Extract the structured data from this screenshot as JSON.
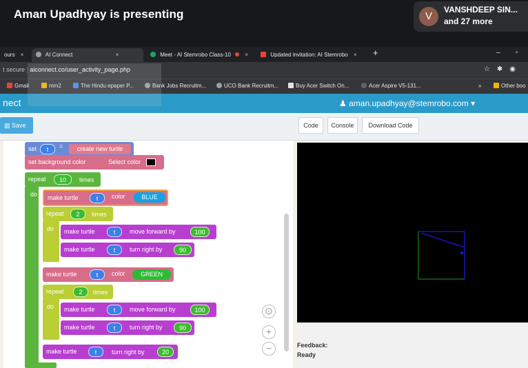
{
  "meet": {
    "presenting": "Aman Upadhyay is presenting",
    "presenter_initial": "V",
    "presenter_name": "VANSHDEEP SIN...",
    "participants_more": "and 27 more"
  },
  "browser": {
    "tabs": [
      {
        "label": "ours",
        "close": "×"
      },
      {
        "label": "AI Connect",
        "close": "×"
      },
      {
        "label": "Meet - AI Stemrobo Class-10",
        "close": "×"
      },
      {
        "label": "Updated invitation: AI Stemrobo",
        "close": "×"
      }
    ],
    "new_tab": "+",
    "window_controls": [
      "–",
      "▫"
    ],
    "address_secure": "t secure",
    "address_url": "aiconnect.co/user_activity_page.php",
    "bookmarks": [
      "Gmail",
      "mm2",
      "The Hindu epaper P...",
      "Bank Jobs Recruitm...",
      "UCO Bank Recruitm...",
      "Buy Acer Switch On...",
      "Acer Aspire V5-131...",
      "Other boo"
    ],
    "bookmarks_more": "»"
  },
  "app": {
    "brand": "nect",
    "user_email": "aman.upadhyay@stemrobo.com",
    "save_label": "Save",
    "tabs": [
      "Code",
      "Console",
      "Download Code"
    ]
  },
  "blocks": {
    "set": "set",
    "var": "t",
    "eq": "=",
    "create_turtle": "create new turtle",
    "set_bg": "set background color",
    "select_color": "Select color",
    "repeat": "repeat",
    "times": "times",
    "do": "do",
    "make_turtle": "make turtle",
    "color": "color",
    "move_forward": "move forward by",
    "turn_right": "turn right by",
    "repeat_outer": "10",
    "repeat_inner_1": "2",
    "repeat_inner_2": "2",
    "color_1": "BLUE",
    "color_2": "GREEN",
    "fwd_1": "100",
    "turn_1": "90",
    "fwd_2": "100",
    "turn_2": "90",
    "turn_final": "20"
  },
  "output": {
    "feedback_label": "Feedback:",
    "feedback_status": "Ready",
    "colors": {
      "blue": "#1a1ae6",
      "green": "#1b9a1b"
    }
  }
}
